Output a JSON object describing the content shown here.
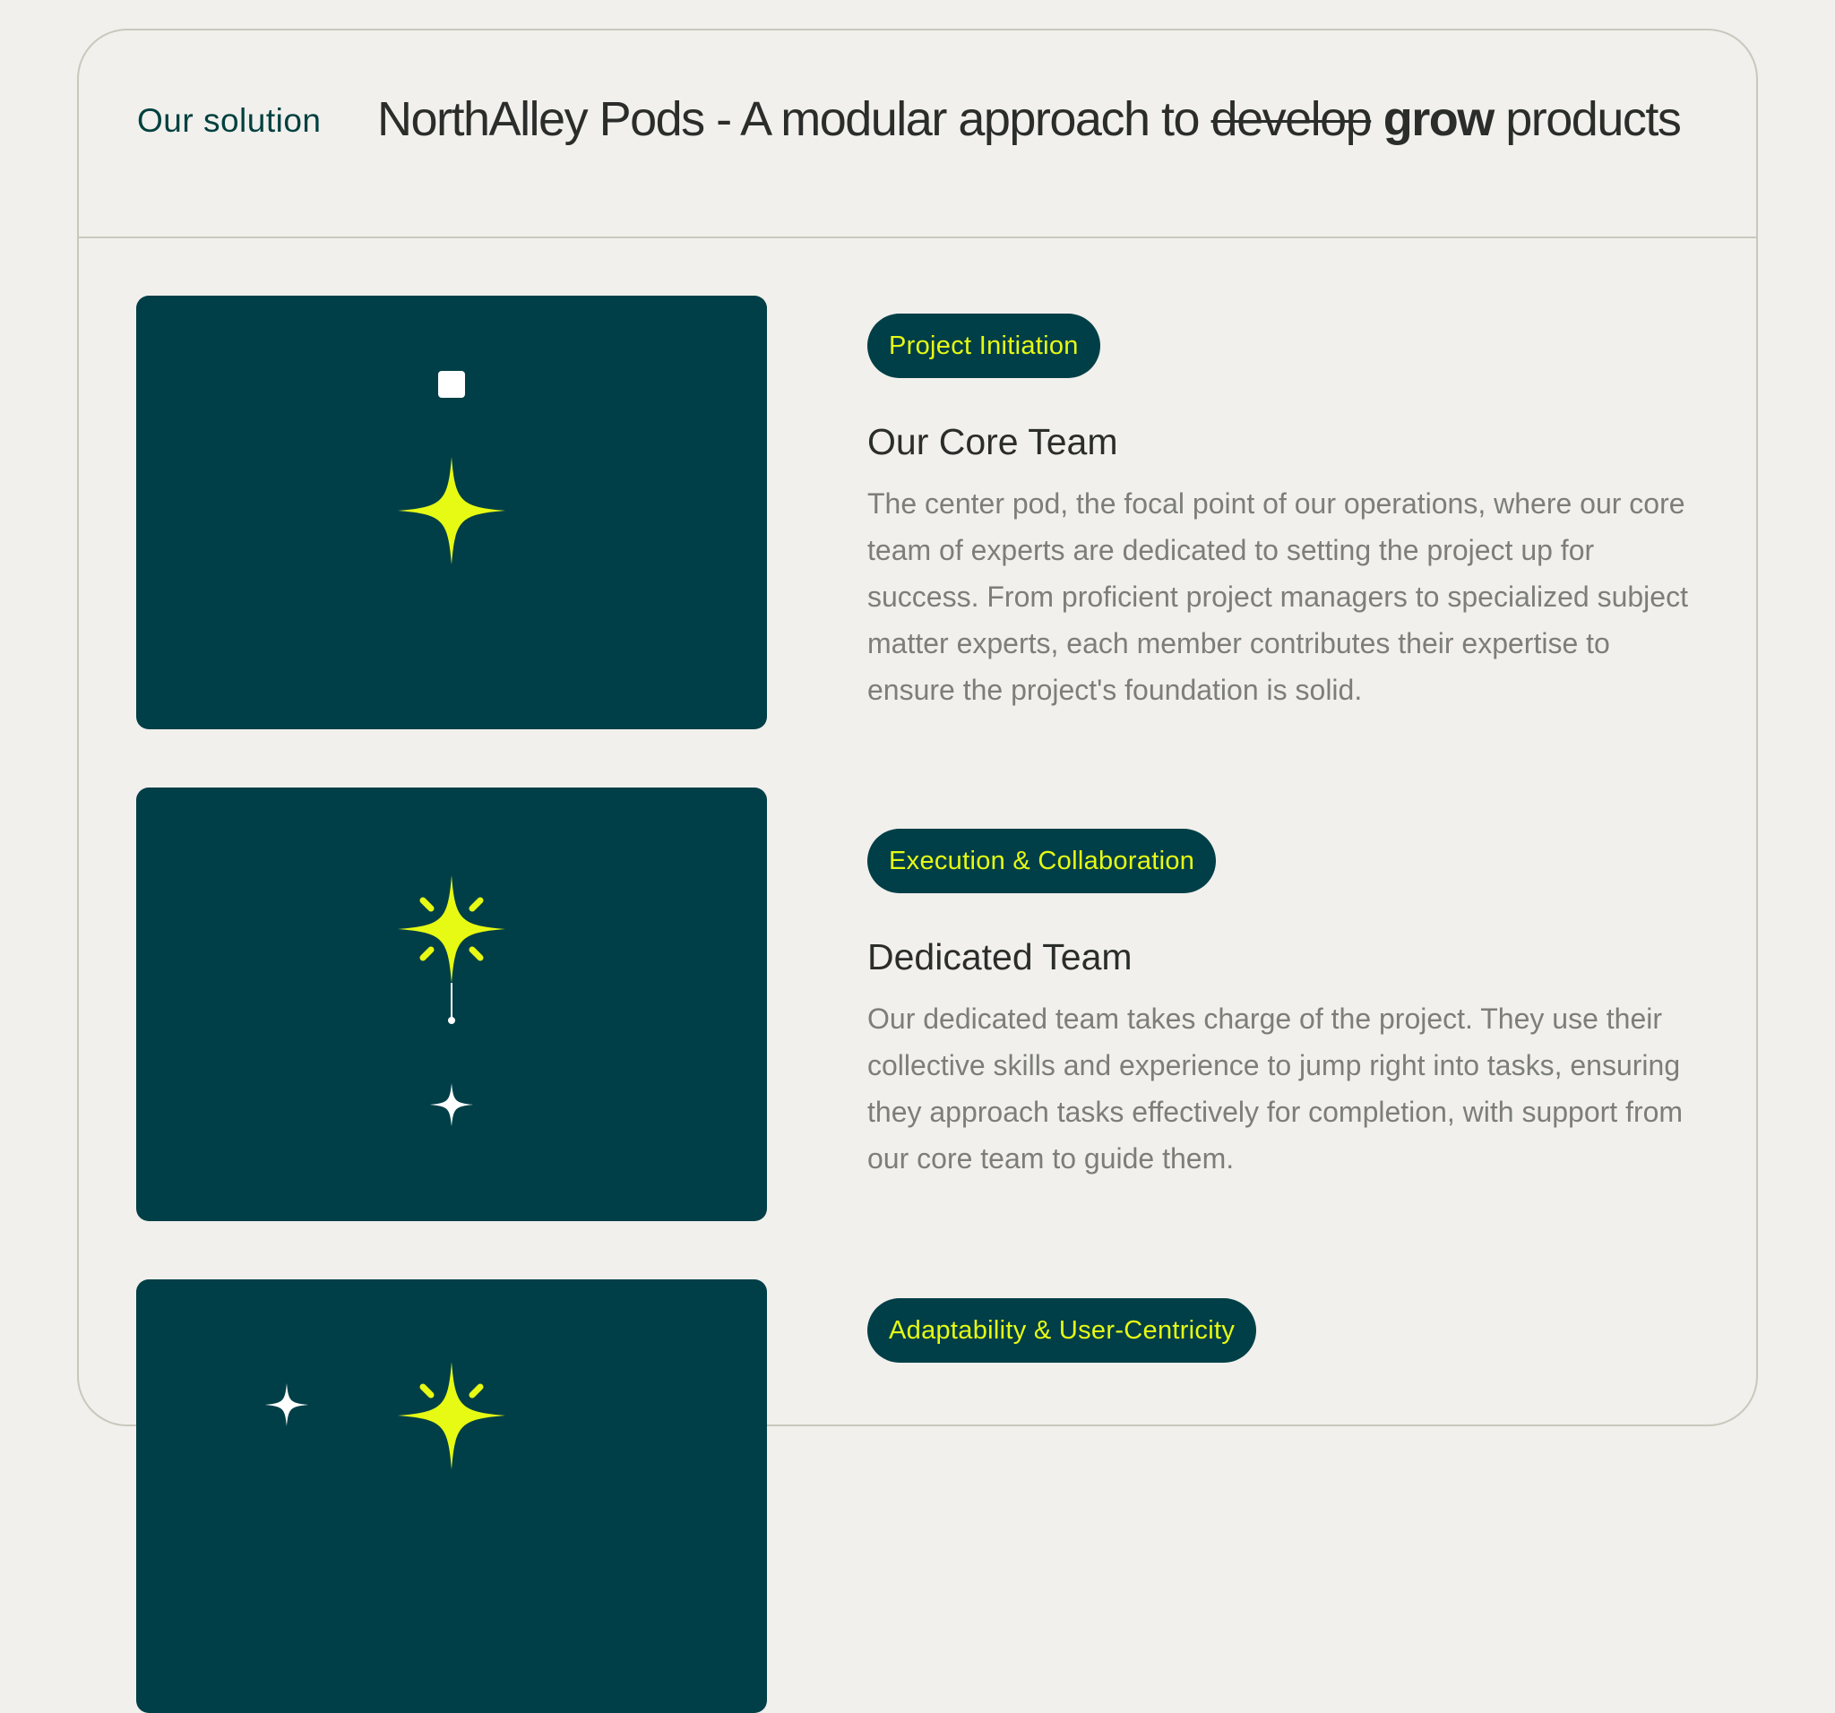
{
  "header": {
    "eyebrow": "Our solution",
    "headline_prefix": "NorthAlley Pods - A modular approach to ",
    "headline_struck": "develop",
    "headline_bold": "grow",
    "headline_suffix": "products"
  },
  "pods": [
    {
      "badge": "Project Initiation",
      "title": "Our Core Team",
      "description": "The center pod, the focal point of our operations, where our core team of experts are dedicated to setting the project up for success. From proficient project managers to specialized subject matter experts, each member contributes their expertise to ensure the project's foundation is solid."
    },
    {
      "badge": "Execution & Collaboration",
      "title": "Dedicated Team",
      "description": "Our dedicated team takes charge of the project. They use their collective skills and experience to jump right into tasks, ensuring they approach tasks effectively for completion, with support from our core team to guide them."
    },
    {
      "badge": "Adaptability & User-Centricity"
    }
  ],
  "colors": {
    "background": "#f1f0ec",
    "pod_bg": "#003f47",
    "accent": "#e6fa14",
    "eyebrow": "#00403f"
  }
}
